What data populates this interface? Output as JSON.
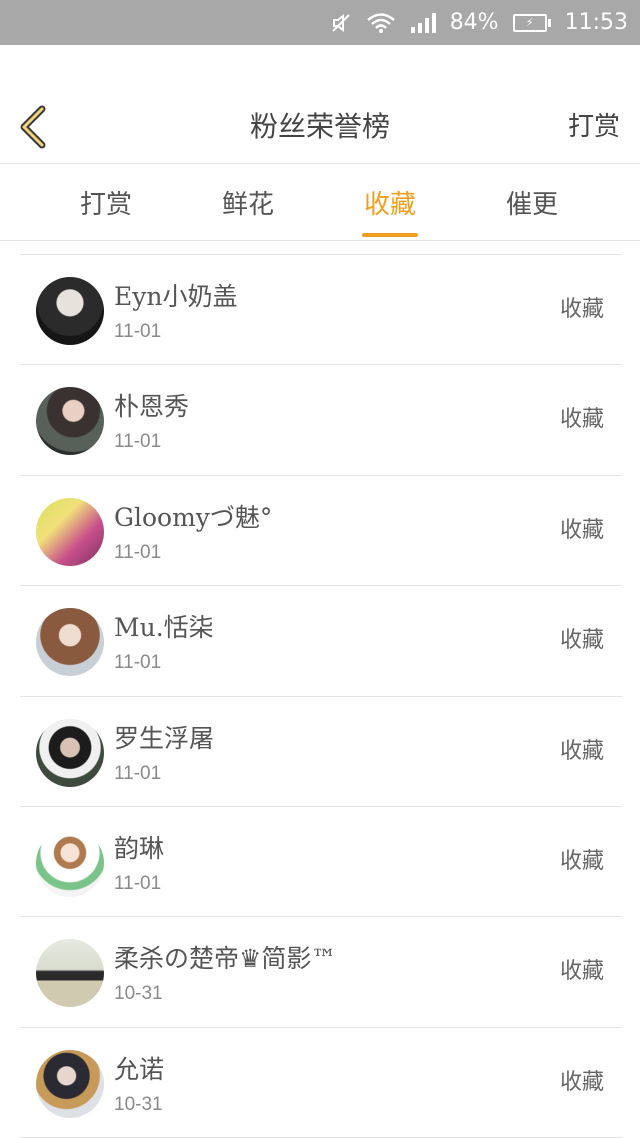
{
  "status_bar": {
    "battery_percent": "84%",
    "time": "11:53",
    "icons": [
      "mute-icon",
      "wifi-icon",
      "signal-icon",
      "battery-charging-icon"
    ]
  },
  "nav": {
    "back_icon": "chevron-left-icon",
    "title": "粉丝荣誉榜",
    "action": "打赏"
  },
  "tabs": [
    {
      "label": "打赏"
    },
    {
      "label": "鲜花"
    },
    {
      "label": "收藏",
      "active": true
    },
    {
      "label": "催更"
    }
  ],
  "colors": {
    "accent": "#f0a020",
    "status_bar": "#a8a8a8",
    "divider": "#e5e5e5"
  },
  "fans": [
    {
      "name": "Eyn小奶盖",
      "date": "11-01",
      "action": "收藏"
    },
    {
      "name": "朴恩秀",
      "date": "11-01",
      "action": "收藏"
    },
    {
      "name": "Gloomyづ魅°",
      "date": "11-01",
      "action": "收藏"
    },
    {
      "name": "Mu.恬柒",
      "date": "11-01",
      "action": "收藏"
    },
    {
      "name": "罗生浮屠",
      "date": "11-01",
      "action": "收藏"
    },
    {
      "name": "韵琳",
      "date": "11-01",
      "action": "收藏"
    },
    {
      "name": "柔杀の楚帝♛简影™",
      "date": "10-31",
      "action": "收藏"
    },
    {
      "name": "允诺",
      "date": "10-31",
      "action": "收藏"
    }
  ]
}
